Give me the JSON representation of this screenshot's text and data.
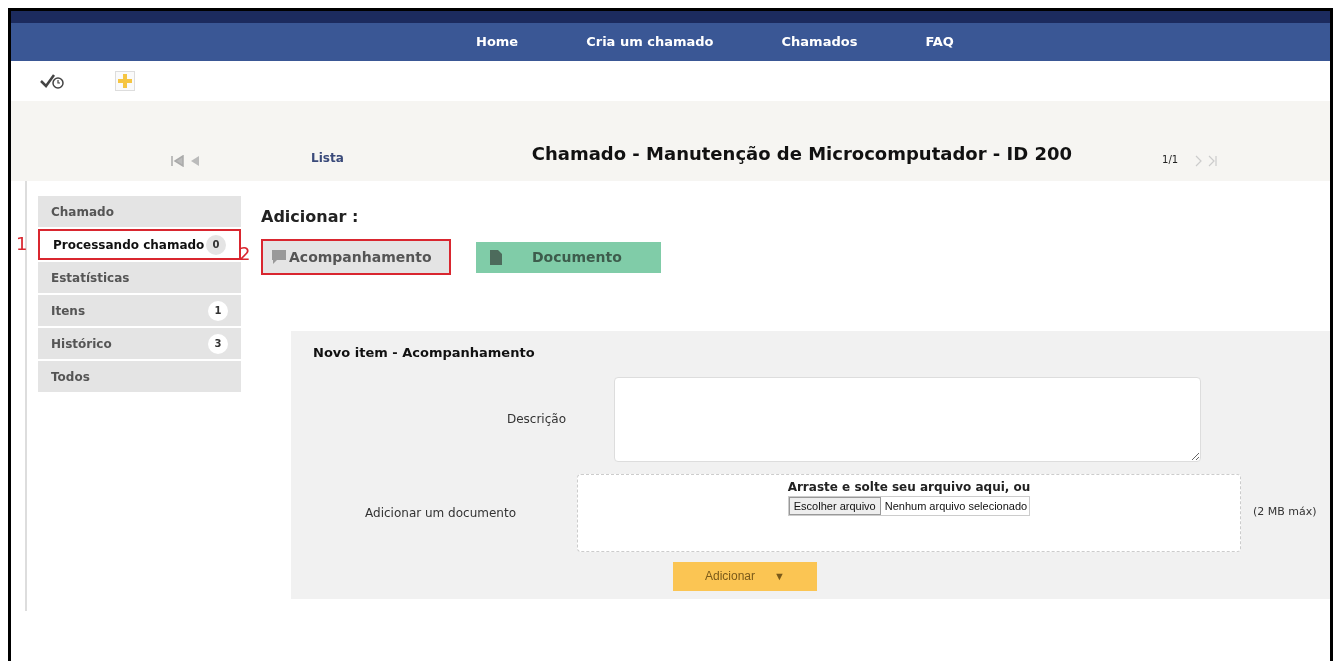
{
  "nav": [
    {
      "label": "Home"
    },
    {
      "label": "Cria um chamado"
    },
    {
      "label": "Chamados"
    },
    {
      "label": "FAQ"
    }
  ],
  "header": {
    "list_link": "Lista",
    "title": "Chamado - Manutenção de Microcomputador - ID 200",
    "pager": "1/1"
  },
  "sidebar": [
    {
      "label": "Chamado",
      "selected": false
    },
    {
      "label": "Processando chamado",
      "count": "0",
      "selected": true,
      "annotation": "1"
    },
    {
      "label": "Estatísticas",
      "selected": false
    },
    {
      "label": "Itens",
      "count": "1",
      "selected": false
    },
    {
      "label": "Histórico",
      "count": "3",
      "selected": false
    },
    {
      "label": "Todos",
      "selected": false
    }
  ],
  "add": {
    "heading": "Adicionar :",
    "buttons": [
      {
        "kind": "followup",
        "label": "Acompanhamento",
        "annotation": "2"
      },
      {
        "kind": "document",
        "label": "Documento"
      }
    ]
  },
  "form": {
    "title": "Novo item - Acompanhamento",
    "description_label": "Descrição",
    "document_label": "Adicionar um documento",
    "drop_text": "Arraste e solte seu arquivo aqui, ou",
    "file_button": "Escolher arquivo",
    "file_status": "Nenhum arquivo selecionado",
    "size_note": "(2 MB máx)",
    "submit": "Adicionar",
    "submit_caret": "▼"
  }
}
